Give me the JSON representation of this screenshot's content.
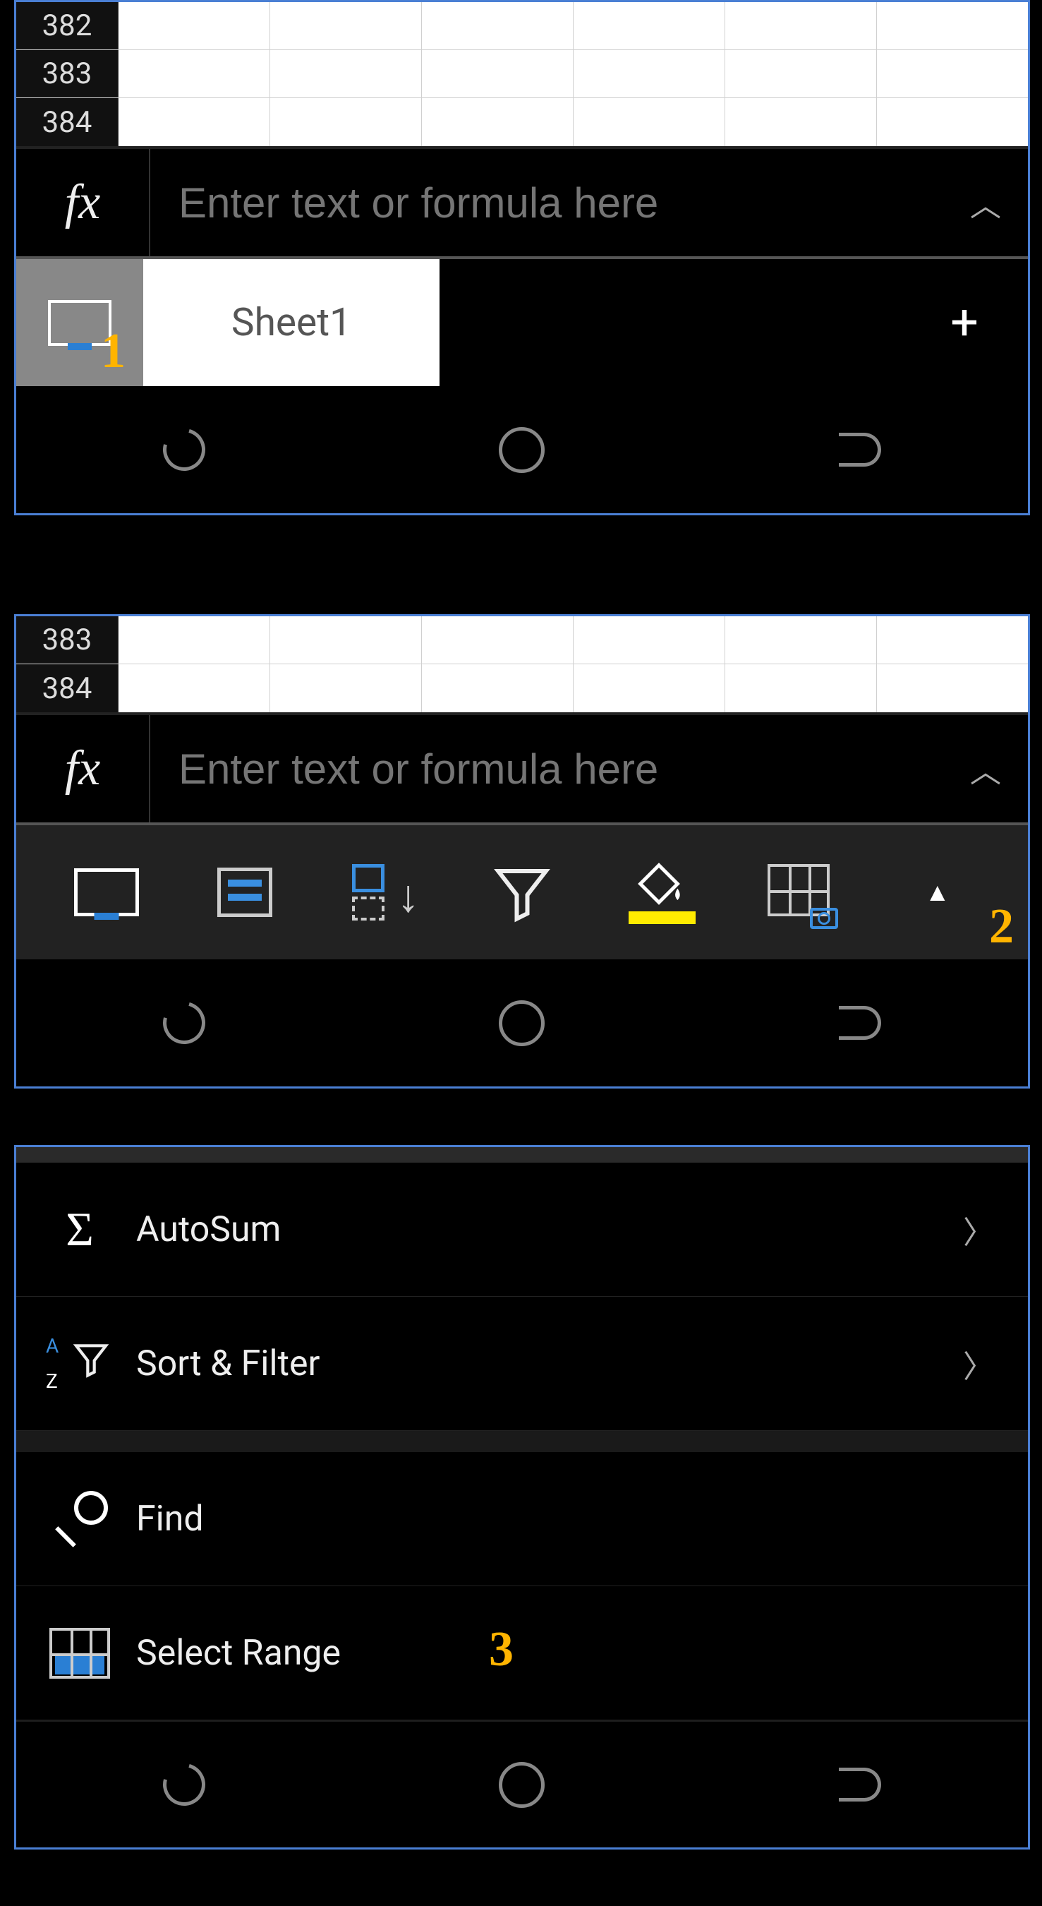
{
  "panel1": {
    "rows": [
      "382",
      "383",
      "384"
    ],
    "fx_label": "fx",
    "fx_placeholder": "Enter text or formula here",
    "sheet_tab": "Sheet1",
    "add_sheet": "+",
    "annotation": "1"
  },
  "panel2": {
    "rows": [
      "383",
      "384"
    ],
    "fx_label": "fx",
    "fx_placeholder": "Enter text or formula here",
    "annotation": "2"
  },
  "panel3": {
    "items": [
      {
        "label": "AutoSum",
        "has_chevron": true
      },
      {
        "label": "Sort & Filter",
        "has_chevron": true
      },
      {
        "label": "Find",
        "has_chevron": false
      },
      {
        "label": "Select Range",
        "has_chevron": false
      }
    ],
    "annotation": "3"
  }
}
